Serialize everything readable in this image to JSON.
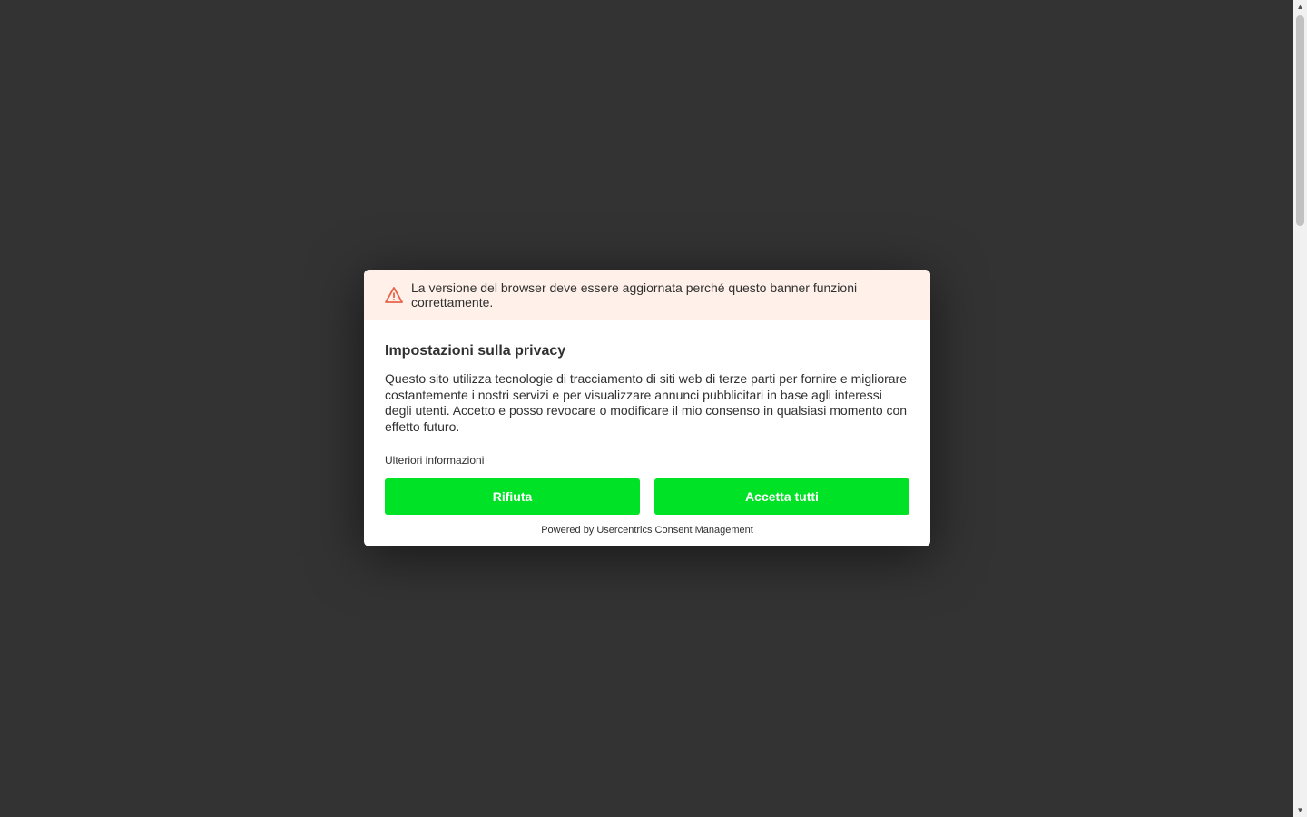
{
  "warning": {
    "text": "La versione del browser deve essere aggiornata perché questo banner funzioni correttamente.",
    "icon": "warning-triangle-icon",
    "icon_color": "#e8654a"
  },
  "consent": {
    "title": "Impostazioni sulla privacy",
    "description": "Questo sito utilizza tecnologie di tracciamento di siti web di terze parti per fornire e migliorare costantemente i nostri servizi e per visualizzare annunci pubblicitari in base agli interessi degli utenti. Accetto e posso revocare o modificare il mio consenso in qualsiasi momento con effetto futuro.",
    "more_info": "Ulteriori informazioni",
    "deny_label": "Rifiuta",
    "accept_label": "Accetta tutti",
    "powered_by": "Powered by Usercentrics Consent Management",
    "button_color": "#00e225"
  }
}
